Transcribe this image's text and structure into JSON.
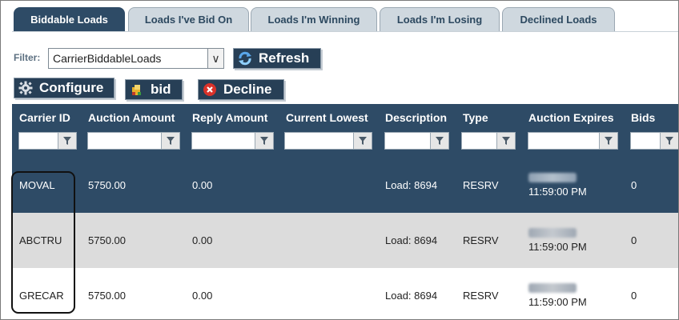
{
  "tabs": [
    {
      "label": "Biddable Loads",
      "active": true
    },
    {
      "label": "Loads I've Bid On",
      "active": false
    },
    {
      "label": "Loads I'm Winning",
      "active": false
    },
    {
      "label": "Loads I'm Losing",
      "active": false
    },
    {
      "label": "Declined Loads",
      "active": false
    }
  ],
  "filter": {
    "label": "Filter:",
    "value": "CarrierBiddableLoads"
  },
  "toolbar": {
    "refresh_label": "Refresh",
    "configure_label": "Configure",
    "bid_label": "bid",
    "decline_label": "Decline"
  },
  "grid": {
    "columns": [
      "Carrier ID",
      "Auction Amount",
      "Reply Amount",
      "Current Lowest",
      "Description",
      "Type",
      "Auction Expires",
      "Bids"
    ],
    "rows": [
      {
        "carrier_id": "MOVAL",
        "auction_amount": "5750.00",
        "reply_amount": "0.00",
        "current_lowest": "",
        "description": "Load: 8694",
        "type": "RESRV",
        "expires_time": "11:59:00 PM",
        "bids": "0"
      },
      {
        "carrier_id": "ABCTRU",
        "auction_amount": "5750.00",
        "reply_amount": "0.00",
        "current_lowest": "",
        "description": "Load: 8694",
        "type": "RESRV",
        "expires_time": "11:59:00 PM",
        "bids": "0"
      },
      {
        "carrier_id": "GRECAR",
        "auction_amount": "5750.00",
        "reply_amount": "0.00",
        "current_lowest": "",
        "description": "Load: 8694",
        "type": "RESRV",
        "expires_time": "11:59:00 PM",
        "bids": "0"
      }
    ]
  },
  "icons": {
    "refresh": "refresh-icon",
    "configure": "gear-icon",
    "bid": "bid-icon",
    "decline": "decline-icon",
    "filter": "funnel-icon"
  },
  "colors": {
    "header": "#2e4b66",
    "selected_row": "#2e4b66",
    "alt_row": "#dcdcdc"
  }
}
